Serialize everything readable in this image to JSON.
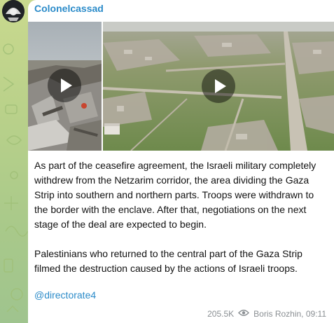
{
  "channel": {
    "name": "Colonelcassad"
  },
  "media": [
    {
      "kind": "video",
      "icon": "play-icon"
    },
    {
      "kind": "video",
      "icon": "play-icon"
    }
  ],
  "message": {
    "paragraphs": [
      "As part of the ceasefire agreement, the Israeli military completely\nwithdrew from the Netzarim corridor, the area dividing the Gaza\nStrip into southern and northern parts. Troops were withdrawn to\nthe border with the enclave. After that, negotiations on the next\nstage of the deal are expected to begin.",
      "Palestinians who returned to the central part of the Gaza Strip\nfilmed the destruction caused by the actions of Israeli troops."
    ],
    "link": "@directorate4"
  },
  "footer": {
    "views": "205.5K",
    "views_icon": "eye-icon",
    "author_time": "Boris Rozhin, 09:11"
  },
  "colors": {
    "link": "#2b8bc9",
    "meta": "#8a8f93",
    "background": "#b9d18a"
  }
}
